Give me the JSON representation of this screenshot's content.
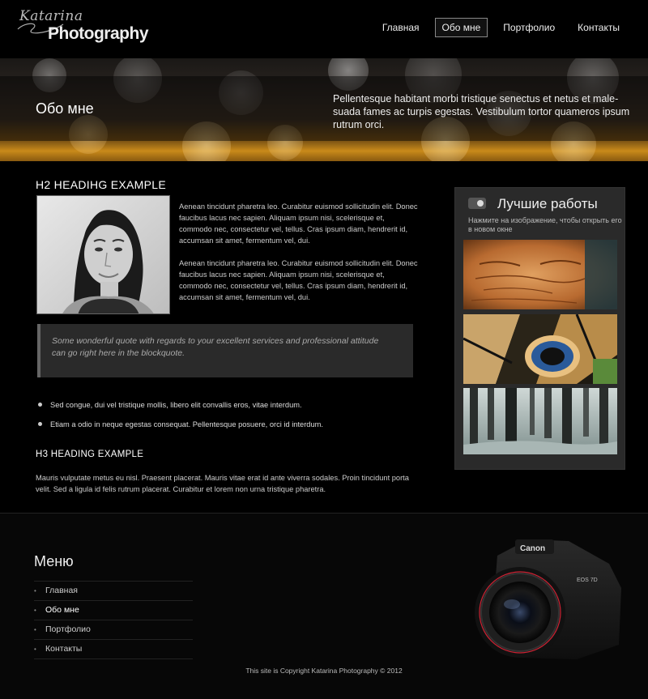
{
  "header": {
    "logo_script": "Katarina",
    "logo_main": "Photography",
    "nav": [
      {
        "label": "Главная",
        "active": false
      },
      {
        "label": "Обо мне",
        "active": true
      },
      {
        "label": "Портфолио",
        "active": false
      },
      {
        "label": "Контакты",
        "active": false
      }
    ]
  },
  "banner": {
    "title": "Обо мне",
    "description": "Pellentesque habitant morbi tristique senectus et netus et male-suada fames ac turpis egestas. Vestibulum tortor quameros ipsum rutrum orci."
  },
  "main": {
    "h2": "H2 HEADIHG EXAMPLE",
    "paragraph1": "Aenean tincidunt pharetra leo. Curabitur euismod sollicitudin elit. Donec faucibus lacus nec sapien. Aliquam ipsum nisi, scelerisque et, commodo nec, consectetur vel, tellus. Cras ipsum diam, hendrerit id, accumsan sit amet, fermentum vel, dui.",
    "paragraph2": "Aenean tincidunt pharetra leo. Curabitur euismod sollicitudin elit. Donec faucibus lacus nec sapien. Aliquam ipsum nisi, scelerisque et, commodo nec, consectetur vel, tellus. Cras ipsum diam, hendrerit id, accumsan sit amet, fermentum vel, dui.",
    "quote": "Some wonderful quote with regards to your excellent services and professional attitude can go right here in the blockquote.",
    "bullets": [
      "Sed congue, dui vel tristique mollis, libero elit convallis eros, vitae interdum.",
      "Etiam a odio in neque egestas consequat. Pellentesque posuere, orci id interdum."
    ],
    "h3": "H3 HEADING EXAMPLE",
    "paragraph3": "Mauris vulputate metus eu nisl. Praesent placerat. Mauris vitae erat id ante viverra sodales. Proin tincidunt porta velit. Sed a ligula id felis rutrum placerat. Curabitur et lorem non urna tristique pharetra."
  },
  "sidebar": {
    "title": "Лучшие работы",
    "hint": "Нажмите на изображение, чтобы открыть его в новом окне"
  },
  "footer": {
    "menu_title": "Меню",
    "menu": [
      {
        "label": "Главная",
        "active": false
      },
      {
        "label": "Обо мне",
        "active": true
      },
      {
        "label": "Портфолио",
        "active": false
      },
      {
        "label": "Контакты",
        "active": false
      }
    ],
    "copyright": "This site is Copyright Katarina Photography © 2012",
    "camera_brand": "Canon",
    "camera_model": "EOS 7D"
  },
  "colors": {
    "background": "#000000",
    "panel": "#2a2a2a",
    "banner_orange": "#c98a1a"
  }
}
